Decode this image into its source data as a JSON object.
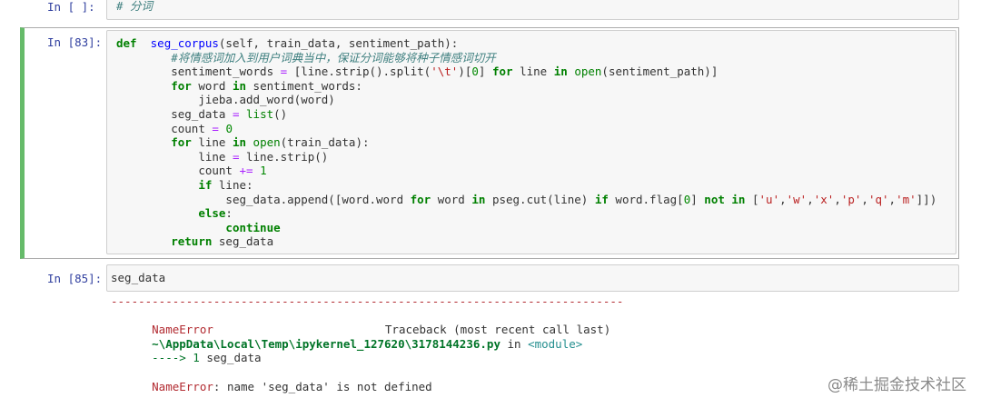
{
  "cell_top": {
    "prompt": "In [ ]:",
    "code": "# 分词"
  },
  "cell_83": {
    "prompt": "In [83]:",
    "lines": [
      {
        "indent": "",
        "parts": [
          [
            "kw",
            "def"
          ],
          [
            "",
            "  "
          ],
          [
            "fn",
            "seg_corpus"
          ],
          [
            "",
            "(self, train_data, sentiment_path):"
          ]
        ]
      },
      {
        "indent": "        ",
        "parts": [
          [
            "cmt",
            "#将情感词加入到用户词典当中，保证分词能够将种子情感词切开"
          ]
        ]
      },
      {
        "indent": "        ",
        "parts": [
          [
            "",
            "sentiment_words "
          ],
          [
            "op",
            "="
          ],
          [
            "",
            " [line.strip().split("
          ],
          [
            "str",
            "'\\t'"
          ],
          [
            "",
            ")["
          ],
          [
            "num",
            "0"
          ],
          [
            "",
            "] "
          ],
          [
            "kw",
            "for"
          ],
          [
            "",
            " line "
          ],
          [
            "kw",
            "in"
          ],
          [
            "",
            " "
          ],
          [
            "bi",
            "open"
          ],
          [
            "",
            "(sentiment_path)]"
          ]
        ]
      },
      {
        "indent": "        ",
        "parts": [
          [
            "kw",
            "for"
          ],
          [
            "",
            " word "
          ],
          [
            "kw",
            "in"
          ],
          [
            "",
            " sentiment_words:"
          ]
        ]
      },
      {
        "indent": "            ",
        "parts": [
          [
            "",
            "jieba.add_word(word)"
          ]
        ]
      },
      {
        "indent": "        ",
        "parts": [
          [
            "",
            "seg_data "
          ],
          [
            "op",
            "="
          ],
          [
            "",
            " "
          ],
          [
            "bi",
            "list"
          ],
          [
            "",
            "()"
          ]
        ]
      },
      {
        "indent": "        ",
        "parts": [
          [
            "",
            "count "
          ],
          [
            "op",
            "="
          ],
          [
            "",
            " "
          ],
          [
            "num",
            "0"
          ]
        ]
      },
      {
        "indent": "        ",
        "parts": [
          [
            "kw",
            "for"
          ],
          [
            "",
            " line "
          ],
          [
            "kw",
            "in"
          ],
          [
            "",
            " "
          ],
          [
            "bi",
            "open"
          ],
          [
            "",
            "(train_data):"
          ]
        ]
      },
      {
        "indent": "            ",
        "parts": [
          [
            "",
            "line "
          ],
          [
            "op",
            "="
          ],
          [
            "",
            " line.strip()"
          ]
        ]
      },
      {
        "indent": "            ",
        "parts": [
          [
            "",
            "count "
          ],
          [
            "op",
            "+="
          ],
          [
            "",
            " "
          ],
          [
            "num",
            "1"
          ]
        ]
      },
      {
        "indent": "            ",
        "parts": [
          [
            "kw",
            "if"
          ],
          [
            "",
            " line:"
          ]
        ]
      },
      {
        "indent": "                ",
        "parts": [
          [
            "",
            "seg_data.append([word.word "
          ],
          [
            "kw",
            "for"
          ],
          [
            "",
            " word "
          ],
          [
            "kw",
            "in"
          ],
          [
            "",
            " pseg.cut(line) "
          ],
          [
            "kw",
            "if"
          ],
          [
            "",
            " word.flag["
          ],
          [
            "num",
            "0"
          ],
          [
            "",
            "] "
          ],
          [
            "kw",
            "not in"
          ],
          [
            "",
            " ["
          ],
          [
            "str",
            "'u'"
          ],
          [
            "",
            ","
          ],
          [
            "str",
            "'w'"
          ],
          [
            "",
            ","
          ],
          [
            "str",
            "'x'"
          ],
          [
            "",
            ","
          ],
          [
            "str",
            "'p'"
          ],
          [
            "",
            ","
          ],
          [
            "str",
            "'q'"
          ],
          [
            "",
            ","
          ],
          [
            "str",
            "'m'"
          ],
          [
            "",
            "]])"
          ]
        ]
      },
      {
        "indent": "            ",
        "parts": [
          [
            "kw",
            "else"
          ],
          [
            "",
            ":"
          ]
        ]
      },
      {
        "indent": "                ",
        "parts": [
          [
            "kw",
            "continue"
          ]
        ]
      },
      {
        "indent": "        ",
        "parts": [
          [
            "kw",
            "return"
          ],
          [
            "",
            " seg_data"
          ]
        ]
      }
    ]
  },
  "cell_85": {
    "prompt": "In [85]:",
    "code": "seg_data",
    "traceback": {
      "separator": "---------------------------------------------------------------------------",
      "error_name": "NameError",
      "header_right": "Traceback (most recent call last)",
      "file_path": "~\\AppData\\Local\\Temp\\ipykernel_127620\\3178144236.py",
      "in_word": " in ",
      "module": "<module>",
      "arrow": "----> 1 ",
      "arrow_code": "seg_data",
      "final_name": "NameError",
      "final_msg": ": name 'seg_data' is not defined"
    }
  },
  "watermark": "@稀土掘金技术社区",
  "colors": {
    "selected_border": "#66bb6a",
    "prompt": "#303f9f",
    "keyword": "#008000",
    "error": "#b22b31"
  }
}
